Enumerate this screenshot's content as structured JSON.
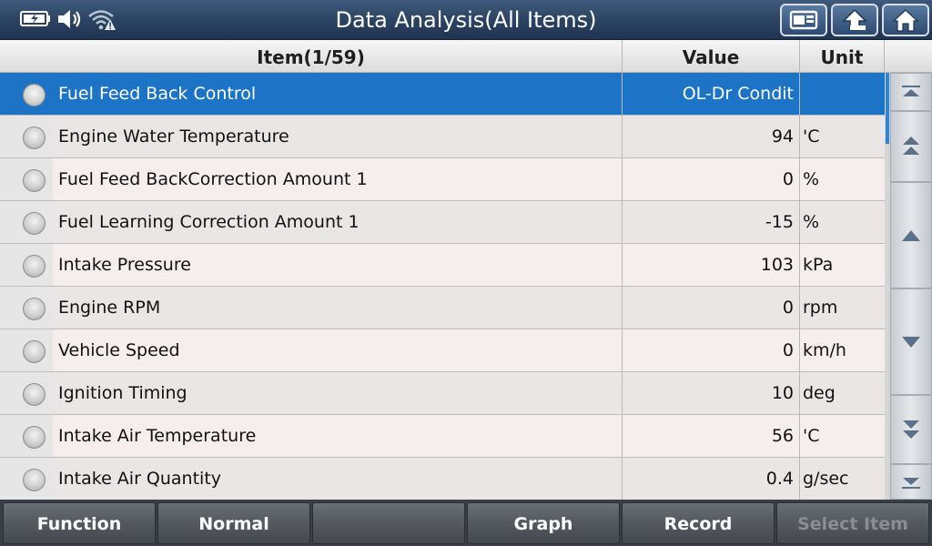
{
  "header": {
    "title": "Data Analysis(All Items)"
  },
  "table": {
    "columns": {
      "item": "Item(1/59)",
      "value": "Value",
      "unit": "Unit"
    },
    "rows": [
      {
        "name": "Fuel Feed Back Control",
        "value": "OL-Dr Condit",
        "unit": ""
      },
      {
        "name": "Engine Water Temperature",
        "value": "94",
        "unit": "'C"
      },
      {
        "name": "Fuel Feed BackCorrection Amount 1",
        "value": "0",
        "unit": "%"
      },
      {
        "name": "Fuel Learning Correction Amount 1",
        "value": "-15",
        "unit": "%"
      },
      {
        "name": "Intake Pressure",
        "value": "103",
        "unit": "kPa"
      },
      {
        "name": "Engine RPM",
        "value": "0",
        "unit": "rpm"
      },
      {
        "name": "Vehicle Speed",
        "value": "0",
        "unit": "km/h"
      },
      {
        "name": "Ignition Timing",
        "value": "10",
        "unit": "deg"
      },
      {
        "name": "Intake Air Temperature",
        "value": "56",
        "unit": "'C"
      },
      {
        "name": "Intake Air Quantity",
        "value": "0.4",
        "unit": "g/sec"
      }
    ]
  },
  "bottom_bar": {
    "function": "Function",
    "normal": "Normal",
    "empty": "",
    "graph": "Graph",
    "record": "Record",
    "select_item": "Select Item"
  },
  "colors": {
    "selected_row": "#1d74c7",
    "title_bar": "#2c4463",
    "bottom_bar": "#565b61"
  },
  "icons": {
    "status": [
      "battery-charging-icon",
      "speaker-icon",
      "wifi-alert-icon"
    ],
    "top_buttons": [
      "screenshot-icon",
      "back-arrow-icon",
      "home-icon"
    ],
    "scroll": [
      "scroll-top-icon",
      "page-up-icon",
      "scroll-up-icon",
      "scroll-down-icon",
      "page-down-icon",
      "scroll-bottom-icon"
    ]
  }
}
